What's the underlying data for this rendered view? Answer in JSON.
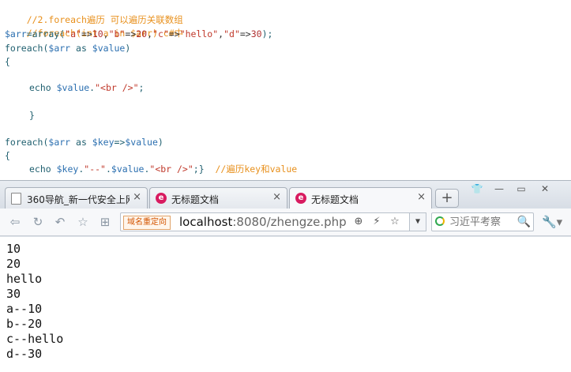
{
  "editor": {
    "lines": {
      "l1": {
        "comment": "//2.foreach遍历 可以遍历关联数组"
      },
      "l2": {
        "comment": "//foreach(int a in $arr) c#中"
      },
      "l3": {
        "var": "$arr",
        "eq": "=array(",
        "k1": "\"a\"",
        "a1": "=>",
        "v1": "10",
        "c1": ",",
        "k2": "\"b\"",
        "a2": "=>",
        "v2": "20",
        "c2": ",",
        "k3": "\"c\"",
        "a3": "=>",
        "v3": "\"hello\"",
        "c3": ",",
        "k4": "\"d\"",
        "a4": "=>",
        "v4": "30",
        "end": ");"
      },
      "l4": {
        "kw": "foreach(",
        "arr": "$arr",
        "as": " as ",
        "val": "$value",
        "close": ")"
      },
      "l5": {
        "brace": "{"
      },
      "l6": {
        "kw": "echo ",
        "val": "$value",
        "dot": ".",
        "str": "\"<br />\"",
        "semi": ";"
      },
      "l7": {
        "brace": "}"
      },
      "l8": {
        "kw": "foreach(",
        "arr": "$arr",
        "as": " as ",
        "key": "$key",
        "arrow": "=>",
        "val": "$value",
        "close": ")"
      },
      "l9": {
        "brace": "{"
      },
      "l10": {
        "kw": "echo ",
        "key": "$key",
        "dot1": ".",
        "sep": "\"--\"",
        "dot2": ".",
        "val": "$value",
        "dot3": ".",
        "str": "\"<br />\"",
        "tail": ";}  ",
        "comment": "//遍历key和value"
      }
    }
  },
  "browser": {
    "tabs": [
      {
        "label": "360导航_新一代安全上网",
        "close": "×"
      },
      {
        "label": "无标题文档",
        "close": "×"
      },
      {
        "label": "无标题文档",
        "close": "×"
      }
    ],
    "new_tab": "+",
    "window_controls": {
      "skin": "👕",
      "minimize": "—",
      "restore": "▭",
      "close": "✕"
    },
    "toolbar": {
      "back": "⇦",
      "refresh": "↻",
      "undo": "↶",
      "favorite": "☆",
      "apps": "⊞",
      "redirect_badge": "域名重定向",
      "url_host": "localhost",
      "url_rest": ":8080/zhengze.php",
      "zoom_icon": "⊕",
      "bolt_icon": "⚡",
      "star_icon": "☆",
      "dropdown": "▼",
      "search_placeholder": "习近平考察",
      "search_button": "🔍",
      "tools": "🔧▾"
    },
    "output_lines": [
      "10",
      "20",
      "hello",
      "30",
      "a--10",
      "b--20",
      "c--hello",
      "d--30"
    ]
  }
}
